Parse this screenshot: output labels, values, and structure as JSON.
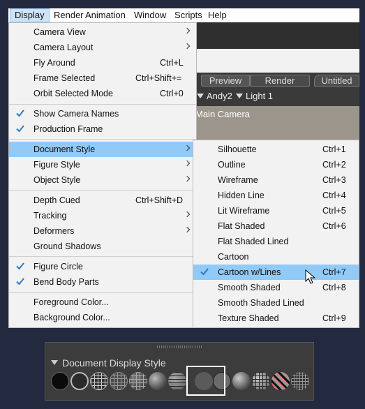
{
  "menubar": {
    "items": [
      "Display",
      "Render",
      "Animation",
      "Window",
      "Scripts",
      "Help"
    ],
    "active": "Display"
  },
  "background": {
    "tabs": [
      "Preview",
      "Render",
      "Untitled"
    ],
    "figures": [
      "Andy2",
      "Light 1"
    ],
    "viewport_label": "Main Camera"
  },
  "display_menu": {
    "camera_view": "Camera View",
    "camera_layout": "Camera Layout",
    "fly_around": "Fly Around",
    "fly_around_sc": "Ctrl+L",
    "frame_selected": "Frame Selected",
    "frame_selected_sc": "Ctrl+Shift+=",
    "orbit_selected": "Orbit Selected Mode",
    "orbit_selected_sc": "Ctrl+0",
    "show_camera_names": "Show Camera Names",
    "production_frame": "Production Frame",
    "document_style": "Document Style",
    "figure_style": "Figure Style",
    "object_style": "Object Style",
    "depth_cued": "Depth Cued",
    "depth_cued_sc": "Ctrl+Shift+D",
    "tracking": "Tracking",
    "deformers": "Deformers",
    "ground_shadows": "Ground Shadows",
    "figure_circle": "Figure Circle",
    "bend_body_parts": "Bend Body Parts",
    "foreground_color": "Foreground Color...",
    "background_color": "Background Color..."
  },
  "document_style_menu": {
    "items": [
      {
        "label": "Silhouette",
        "shortcut": "Ctrl+1"
      },
      {
        "label": "Outline",
        "shortcut": "Ctrl+2"
      },
      {
        "label": "Wireframe",
        "shortcut": "Ctrl+3"
      },
      {
        "label": "Hidden Line",
        "shortcut": "Ctrl+4"
      },
      {
        "label": "Lit Wireframe",
        "shortcut": "Ctrl+5"
      },
      {
        "label": "Flat Shaded",
        "shortcut": "Ctrl+6"
      },
      {
        "label": "Flat Shaded Lined",
        "shortcut": ""
      },
      {
        "label": "Cartoon",
        "shortcut": ""
      },
      {
        "label": "Cartoon w/Lines",
        "shortcut": "Ctrl+7"
      },
      {
        "label": "Smooth Shaded",
        "shortcut": "Ctrl+8"
      },
      {
        "label": "Smooth Shaded Lined",
        "shortcut": ""
      },
      {
        "label": "Texture Shaded",
        "shortcut": "Ctrl+9"
      }
    ],
    "checked": "Cartoon w/Lines"
  },
  "panel": {
    "title": "Document Display Style"
  },
  "colors": {
    "highlight": "#91c9f7",
    "menu_bg": "#f2f2f2",
    "page_bg": "#232a3f",
    "check": "#2b79c2"
  },
  "icons": [
    "check-icon",
    "submenu-arrow-icon",
    "collapse-triangle-icon",
    "mouse-cursor-icon"
  ]
}
